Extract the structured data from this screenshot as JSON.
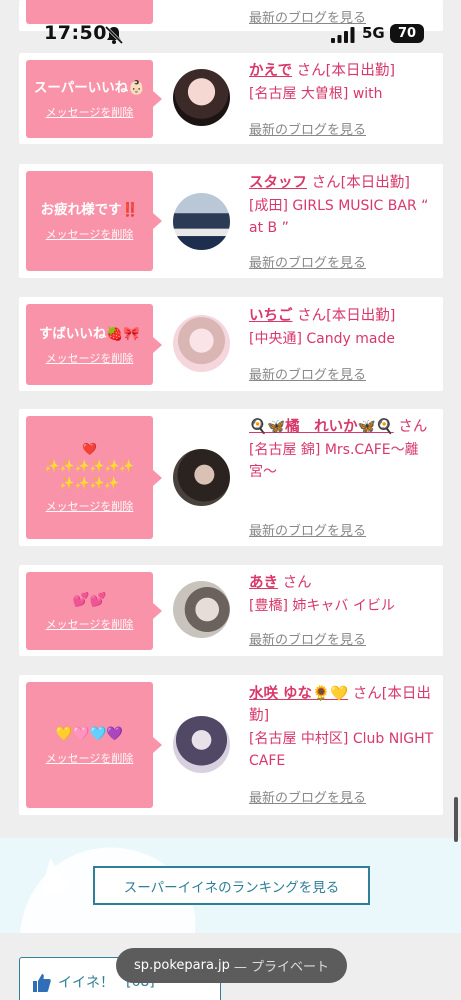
{
  "status_bar": {
    "time": "17:50",
    "network": "5G",
    "battery": "70"
  },
  "top_partial": {
    "blog_link": "最新のブログを見る"
  },
  "cards": [
    {
      "message": "スーパーいいね👶🏻",
      "delete_label": "メッセージを削除",
      "name": "かえで",
      "suffix": " さん[本日出勤]",
      "shop": "[名古屋 大曽根] with",
      "blog_link": "最新のブログを見る"
    },
    {
      "message": "お疲れ様です‼️",
      "delete_label": "メッセージを削除",
      "name": "スタッフ",
      "suffix": " さん[本日出勤]",
      "shop": "[成田] GIRLS MUSIC BAR “ at B ”",
      "blog_link": "最新のブログを見る"
    },
    {
      "message": "すばいいね🍓🎀",
      "delete_label": "メッセージを削除",
      "name": "いちご",
      "suffix": " さん[本日出勤]",
      "shop": "[中央通] Candy made",
      "blog_link": "最新のブログを見る"
    },
    {
      "message": "❤️\n✨✨✨✨✨✨\n✨✨✨✨",
      "delete_label": "メッセージを削除",
      "name": "🍳🦋橘　れいか🦋🍳",
      "suffix": " さん",
      "shop": "[名古屋 錦] Mrs.CAFE〜離宮〜",
      "blog_link": "最新のブログを見る"
    },
    {
      "message": "💕💕",
      "delete_label": "メッセージを削除",
      "name": "あき",
      "suffix": " さん",
      "shop": "[豊橋] 姉キャバ イビル",
      "blog_link": "最新のブログを見る"
    },
    {
      "message": "💛🩷🩵💜",
      "delete_label": "メッセージを削除",
      "name": "水咲 ゆな🌻💛",
      "suffix": " さん[本日出勤]",
      "shop": "[名古屋 中村区] Club NIGHT CAFE",
      "blog_link": "最新のブログを見る"
    }
  ],
  "ranking_button": "スーパーイイネのランキングを見る",
  "iine_button": {
    "label": "イイネ！",
    "count": "[68]"
  },
  "url_bar": {
    "domain": "sp.pokepara.jp",
    "mode": "— プライベート"
  },
  "colors": {
    "bubble": "#f993a9",
    "accent_pink": "#d8386a",
    "teal": "#2e7f97"
  }
}
